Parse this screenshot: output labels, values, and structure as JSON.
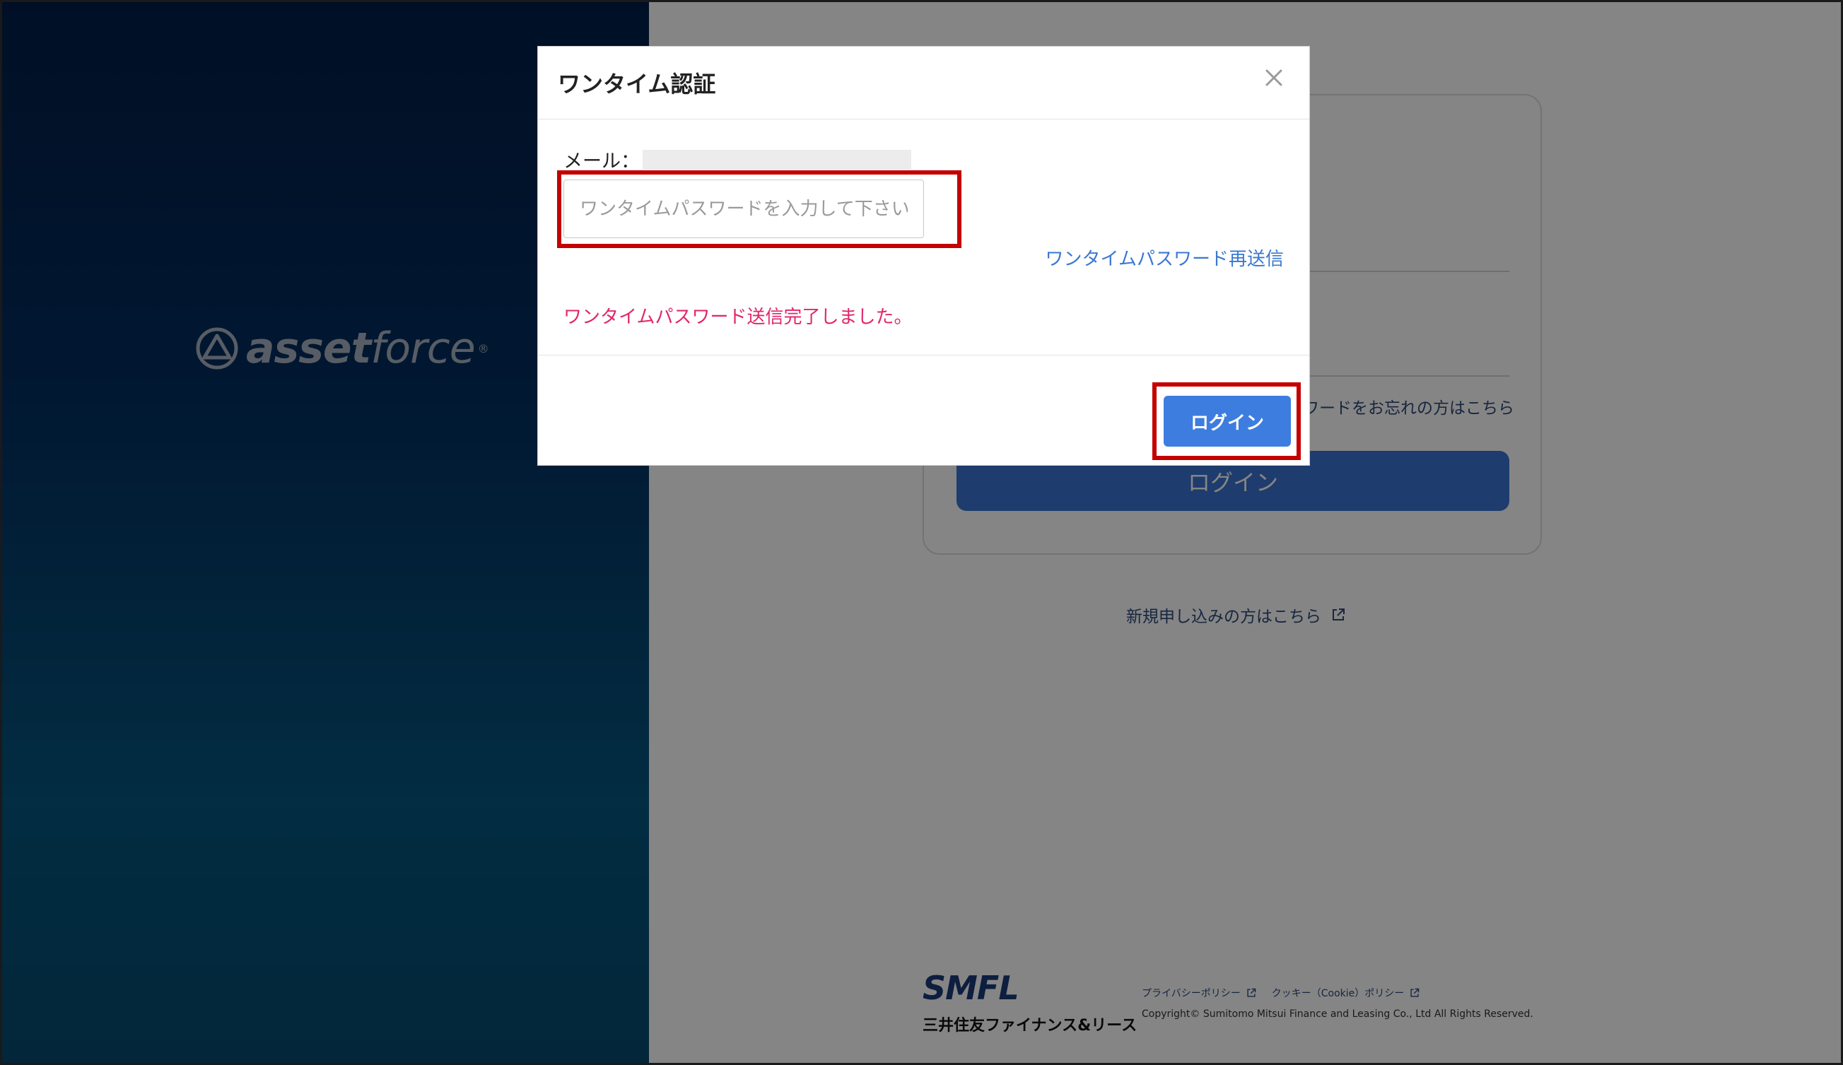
{
  "brand": {
    "logo_text_bold": "asset",
    "logo_text_thin": "force",
    "logo_mark": "®"
  },
  "background_login": {
    "forgot_password_partial": "ワードをお忘れの方はこちら",
    "login_button": "ログイン",
    "signup_link": "新規申し込みの方はこちら"
  },
  "footer": {
    "smfl_logo": "SMFL",
    "company_name": "三井住友ファイナンス&リース",
    "privacy_link": "プライバシーポリシー",
    "cookie_link": "クッキー（Cookie）ポリシー",
    "copyright": "Copyright© Sumitomo Mitsui Finance and Leasing Co., Ltd All Rights Reserved."
  },
  "modal": {
    "title": "ワンタイム認証",
    "email_label": "メール：",
    "otp_placeholder": "ワンタイムパスワードを入力して下さい",
    "otp_value": "",
    "resend_link": "ワンタイムパスワード再送信",
    "sent_message": "ワンタイムパスワード送信完了しました。",
    "login_button": "ログイン"
  },
  "colors": {
    "brand_dark": "#011e48",
    "brand_teal": "#05567f",
    "accent_blue": "#3e7de0",
    "link_blue": "#3978d0",
    "message_pink": "#e0266a",
    "highlight_red": "#c40000"
  },
  "icons": {
    "close": "close-icon",
    "external": "external-link-icon",
    "logo": "asset-force-logo-icon"
  }
}
